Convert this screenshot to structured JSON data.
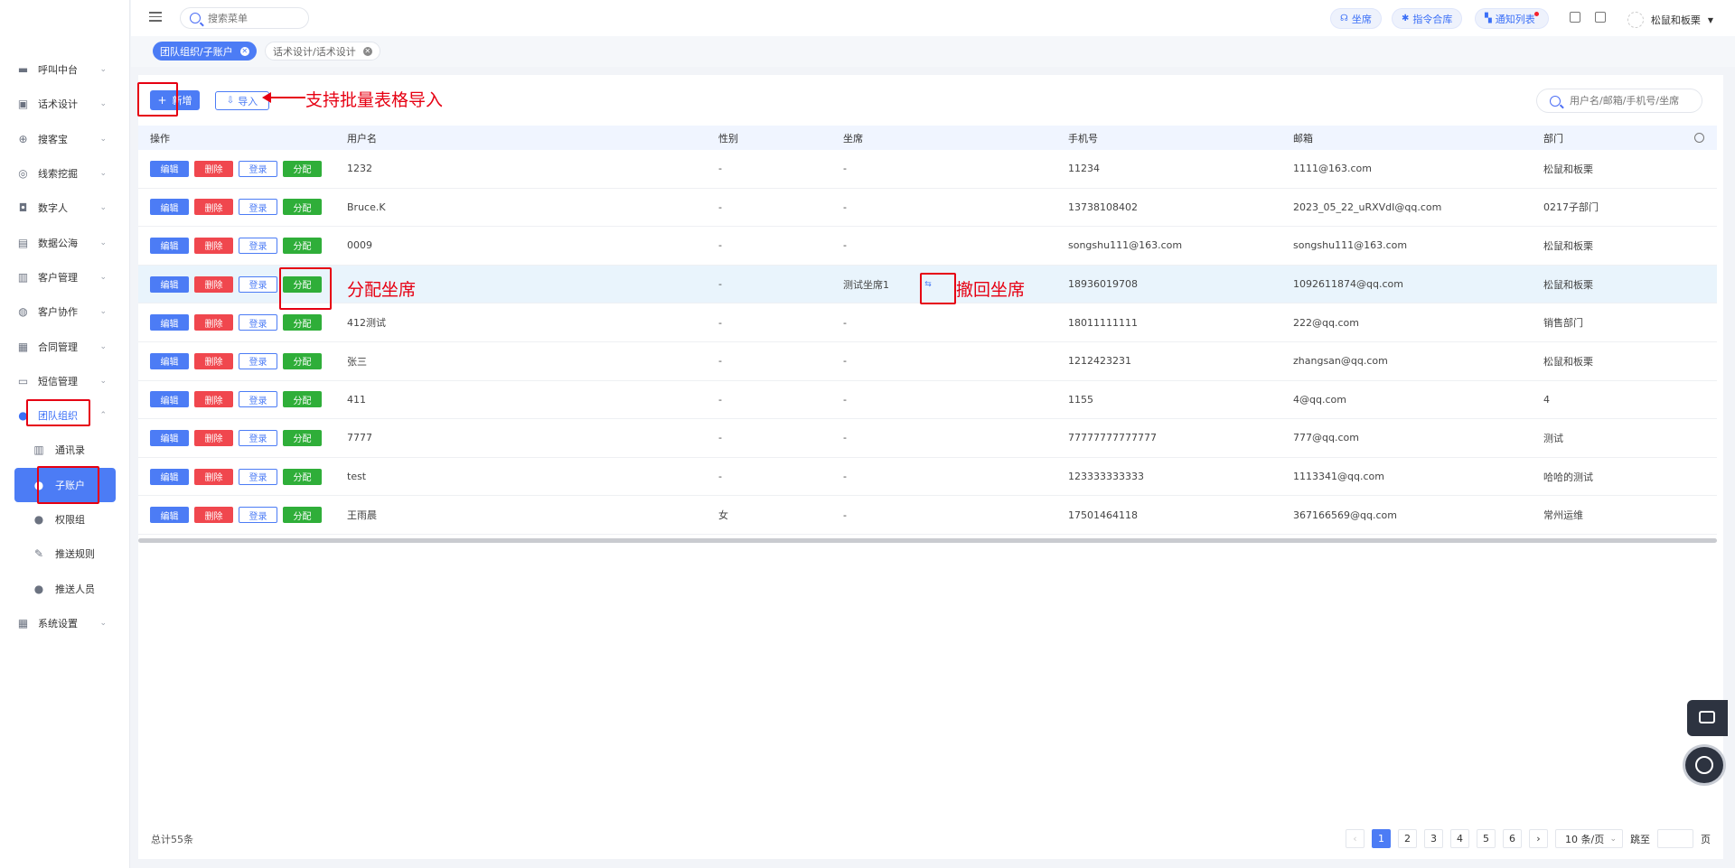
{
  "sidebar": {
    "items": [
      {
        "label": "呼叫中台",
        "icon": "monitor-icon"
      },
      {
        "label": "话术设计",
        "icon": "book-icon"
      },
      {
        "label": "搜客宝",
        "icon": "search-circle-icon"
      },
      {
        "label": "线索挖掘",
        "icon": "target-icon"
      },
      {
        "label": "数字人",
        "icon": "robot-icon"
      },
      {
        "label": "数据公海",
        "icon": "chart-icon"
      },
      {
        "label": "客户管理",
        "icon": "contacts-icon"
      },
      {
        "label": "客户协作",
        "icon": "collab-icon"
      },
      {
        "label": "合同管理",
        "icon": "clipboard-icon"
      },
      {
        "label": "短信管理",
        "icon": "message-icon"
      },
      {
        "label": "团队组织",
        "icon": "user-icon"
      }
    ],
    "sub_items": [
      {
        "label": "通讯录",
        "icon": "address-book-icon"
      },
      {
        "label": "子账户",
        "icon": "sub-account-icon"
      },
      {
        "label": "权限组",
        "icon": "permission-icon"
      },
      {
        "label": "推送规则",
        "icon": "rule-icon"
      },
      {
        "label": "推送人员",
        "icon": "push-user-icon"
      }
    ],
    "bottom_item": {
      "label": "系统设置",
      "icon": "grid-icon"
    }
  },
  "topbar": {
    "search_placeholder": "搜索菜单",
    "pills": [
      "坐席",
      "指令合库",
      "通知列表"
    ],
    "user_name": "松鼠和板栗"
  },
  "tabs": [
    {
      "label": "团队组织/子账户",
      "active": true
    },
    {
      "label": "话术设计/话术设计",
      "active": false
    }
  ],
  "toolbar": {
    "new_label": "新增",
    "import_label": "导入",
    "search_placeholder": "用户名/邮箱/手机号/坐席"
  },
  "table": {
    "headers": [
      "操作",
      "用户名",
      "性别",
      "坐席",
      "手机号",
      "邮箱",
      "部门"
    ],
    "op_labels": {
      "edit": "编辑",
      "delete": "删除",
      "login": "登录",
      "assign": "分配"
    },
    "rows": [
      {
        "user": "1232",
        "sex": "-",
        "seat": "-",
        "phone": "11234",
        "email": "1111@163.com",
        "dept": "松鼠和板栗"
      },
      {
        "user": "Bruce.K",
        "sex": "-",
        "seat": "-",
        "phone": "13738108402",
        "email": "2023_05_22_uRXVdI@qq.com",
        "dept": "0217子部门"
      },
      {
        "user": "0009",
        "sex": "-",
        "seat": "-",
        "phone": "songshu111@163.com",
        "email": "songshu111@163.com",
        "dept": "松鼠和板栗"
      },
      {
        "user": "",
        "sex": "-",
        "seat": "测试坐席1",
        "phone": "18936019708",
        "email": "1092611874@qq.com",
        "dept": "松鼠和板栗"
      },
      {
        "user": "412测试",
        "sex": "-",
        "seat": "-",
        "phone": "18011111111",
        "email": "222@qq.com",
        "dept": "销售部门"
      },
      {
        "user": "张三",
        "sex": "-",
        "seat": "-",
        "phone": "1212423231",
        "email": "zhangsan@qq.com",
        "dept": "松鼠和板栗"
      },
      {
        "user": "411",
        "sex": "-",
        "seat": "-",
        "phone": "1155",
        "email": "4@qq.com",
        "dept": "4"
      },
      {
        "user": "7777",
        "sex": "-",
        "seat": "-",
        "phone": "77777777777777",
        "email": "777@qq.com",
        "dept": "测试"
      },
      {
        "user": "test",
        "sex": "-",
        "seat": "-",
        "phone": "123333333333",
        "email": "1113341@qq.com",
        "dept": "哈哈的测试"
      },
      {
        "user": "王雨晨",
        "sex": "女",
        "seat": "-",
        "phone": "17501464118",
        "email": "367166569@qq.com",
        "dept": "常州运维"
      }
    ]
  },
  "footer": {
    "total": "总计55条",
    "pages": [
      "1",
      "2",
      "3",
      "4",
      "5",
      "6"
    ],
    "current_page": "1",
    "page_size": "10 条/页",
    "jump_label": "跳至",
    "page_suffix": "页"
  },
  "annotations": {
    "import": "支持批量表格导入",
    "assign": "分配坐席",
    "revoke": "撤回坐席"
  },
  "colors": {
    "primary": "#4c7cf5",
    "danger": "#f0474e",
    "success": "#2fae39",
    "annotation": "#e60012"
  }
}
